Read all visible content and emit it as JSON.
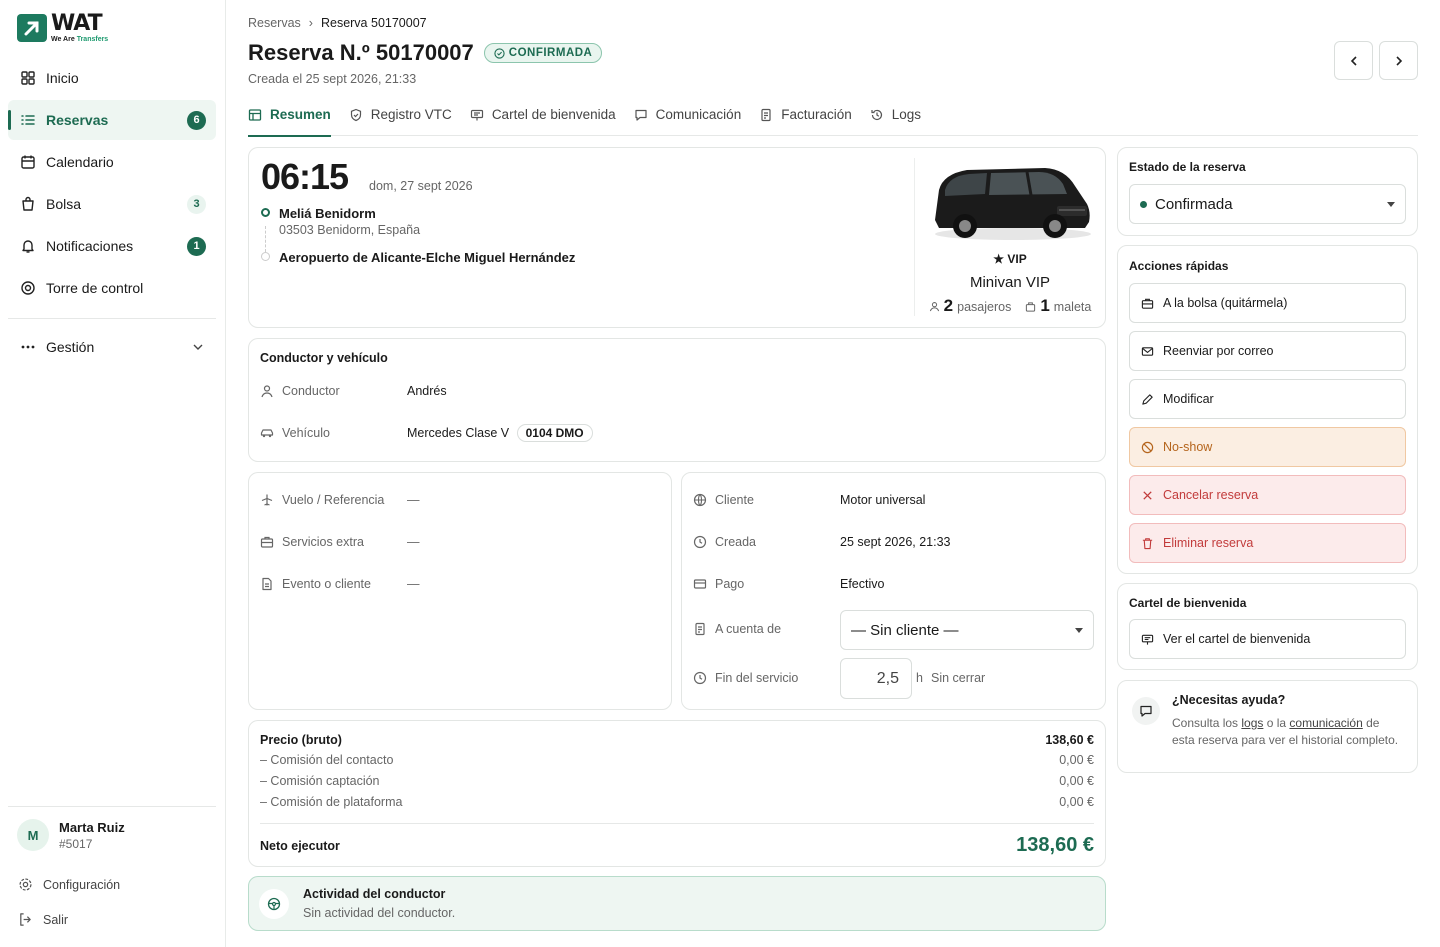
{
  "brand": {
    "name": "WAT",
    "tagline_1": "We Are",
    "tagline_2": "Transfers"
  },
  "sidebar": {
    "items": [
      {
        "label": "Inicio",
        "icon": "grid-icon"
      },
      {
        "label": "Reservas",
        "icon": "list-icon",
        "badge": "6",
        "active": true
      },
      {
        "label": "Calendario",
        "icon": "calendar-icon"
      },
      {
        "label": "Bolsa",
        "icon": "bag-icon",
        "badge": "3"
      },
      {
        "label": "Notificaciones",
        "icon": "bell-icon",
        "badge": "1"
      },
      {
        "label": "Torre de control",
        "icon": "target-icon"
      }
    ],
    "gestion": "Gestión",
    "user": {
      "initial": "M",
      "name": "Marta Ruiz",
      "id": "#5017"
    },
    "config": "Configuración",
    "logout": "Salir"
  },
  "header": {
    "breadcrumb_root": "Reservas",
    "breadcrumb_current": "Reserva 50170007",
    "title": "Reserva N.º 50170007",
    "status": "CONFIRMADA",
    "created": "Creada el 25 sept 2026, 21:33"
  },
  "tabs": [
    "Resumen",
    "Registro VTC",
    "Cartel de bienvenida",
    "Comunicación",
    "Facturación",
    "Logs"
  ],
  "trip": {
    "time": "06:15",
    "date": "dom, 27 sept 2026",
    "origin_name": "Meliá Benidorm",
    "origin_address": "03503 Benidorm, España",
    "destination_name": "Aeropuerto de Alicante-Elche Miguel Hernández",
    "vehicle_tag": "★ VIP",
    "vehicle_name": "Minivan VIP",
    "passengers": "2",
    "passengers_label": "pasajeros",
    "luggage": "1",
    "luggage_label": "maleta"
  },
  "driver_vehicle": {
    "title": "Conductor y vehículo",
    "driver_label": "Conductor",
    "driver_value": "Andrés",
    "vehicle_label": "Vehículo",
    "vehicle_value": "Mercedes Clase V",
    "plate": "0104 DMO"
  },
  "details_left": [
    {
      "label": "Vuelo / Referencia",
      "value": "—"
    },
    {
      "label": "Servicios extra",
      "value": "—"
    },
    {
      "label": "Evento o cliente",
      "value": "—"
    }
  ],
  "details_right": {
    "client_label": "Cliente",
    "client_value": "Motor universal",
    "created_label": "Creada",
    "created_value": "25 sept 2026, 21:33",
    "payment_label": "Pago",
    "payment_value": "Efectivo",
    "account_label": "A cuenta de",
    "account_value": "— Sin cliente —",
    "end_label": "Fin del servicio",
    "end_value": "2,5",
    "end_unit": "h",
    "end_status": "Sin cerrar"
  },
  "price": {
    "gross_label": "Precio (bruto)",
    "gross_value": "138,60 €",
    "rows": [
      {
        "label": "– Comisión del contacto",
        "value": "0,00 €"
      },
      {
        "label": "– Comisión captación",
        "value": "0,00 €"
      },
      {
        "label": "– Comisión de plataforma",
        "value": "0,00 €"
      }
    ],
    "net_label": "Neto ejecutor",
    "net_value": "138,60 €"
  },
  "activity": {
    "title": "Actividad del conductor",
    "text": "Sin actividad del conductor."
  },
  "state": {
    "title": "Estado de la reserva",
    "value": "Confirmada"
  },
  "quick_actions": {
    "title": "Acciones rápidas",
    "items": [
      {
        "label": "A la bolsa (quitármela)"
      },
      {
        "label": "Reenviar por correo"
      },
      {
        "label": "Modificar"
      },
      {
        "label": "No-show"
      },
      {
        "label": "Cancelar reserva"
      },
      {
        "label": "Eliminar reserva"
      }
    ]
  },
  "welcome_sign": {
    "title": "Cartel de bienvenida",
    "button": "Ver el cartel de bienvenida"
  },
  "help": {
    "title": "¿Necesitas ayuda?",
    "t1": "Consulta los ",
    "logs": "logs",
    "t2": " o la ",
    "comm": "comunicación",
    "t3": " de esta reserva para ver el historial completo."
  },
  "colors": {
    "accent": "#1d6b52",
    "warn": "#b5651d",
    "danger": "#c23b3b"
  }
}
